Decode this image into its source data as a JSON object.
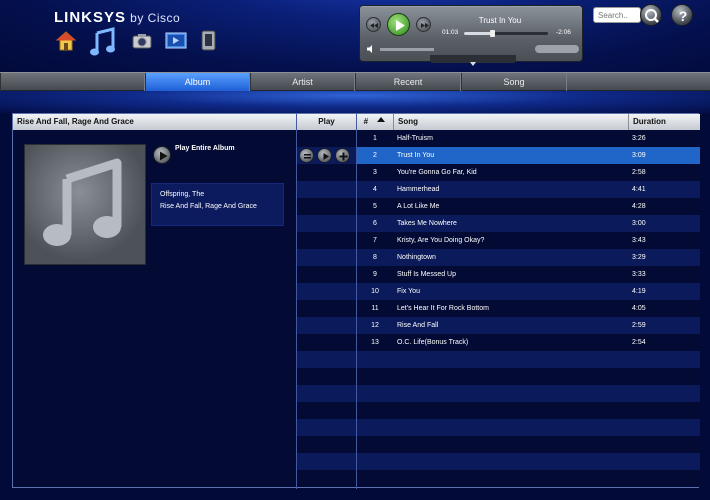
{
  "header": {
    "brand": "LINKSYS",
    "by": "by Cisco",
    "search_placeholder": "Search.."
  },
  "player": {
    "track": "Trust In You",
    "elapsed": "01:03",
    "remaining": "-2:06",
    "progress": 0.33
  },
  "tabs": [
    {
      "label": "Album",
      "active": true
    },
    {
      "label": "Artist",
      "active": false
    },
    {
      "label": "Recent",
      "active": false
    },
    {
      "label": "Song",
      "active": false
    }
  ],
  "album": {
    "title": "Rise And Fall, Rage And Grace",
    "play_all": "Play Entire Album",
    "artist": "Offspring, The",
    "album_name": "Rise And Fall, Rage And Grace"
  },
  "columns": {
    "play": "Play",
    "num": "#",
    "song": "Song",
    "duration": "Duration"
  },
  "tracks": [
    {
      "num": "1",
      "song": "Half-Truism",
      "duration": "3:26"
    },
    {
      "num": "2",
      "song": "Trust In You",
      "duration": "3:09",
      "selected": true
    },
    {
      "num": "3",
      "song": "You're Gonna Go Far, Kid",
      "duration": "2:58"
    },
    {
      "num": "4",
      "song": "Hammerhead",
      "duration": "4:41"
    },
    {
      "num": "5",
      "song": "A Lot Like Me",
      "duration": "4:28"
    },
    {
      "num": "6",
      "song": "Takes Me Nowhere",
      "duration": "3:00"
    },
    {
      "num": "7",
      "song": "Kristy, Are You Doing Okay?",
      "duration": "3:43"
    },
    {
      "num": "8",
      "song": "Nothingtown",
      "duration": "3:29"
    },
    {
      "num": "9",
      "song": "Stuff Is Messed Up",
      "duration": "3:33"
    },
    {
      "num": "10",
      "song": "Fix You",
      "duration": "4:19"
    },
    {
      "num": "11",
      "song": "Let's Hear It For Rock Bottom",
      "duration": "4:05"
    },
    {
      "num": "12",
      "song": "Rise And Fall",
      "duration": "2:59"
    },
    {
      "num": "13",
      "song": "O.C. Life(Bonus Track)",
      "duration": "2:54"
    }
  ],
  "colors": {
    "selected_row": "#1f66c8",
    "row_dark": "#030b35",
    "row_light": "#0b1a5a"
  },
  "icons": [
    "home-icon",
    "music-icon",
    "photo-icon",
    "video-icon",
    "device-icon",
    "search-icon",
    "help-icon",
    "rewind-icon",
    "play-icon",
    "forward-icon",
    "volume-icon",
    "sort-ascending-icon",
    "add-to-queue-icon"
  ]
}
